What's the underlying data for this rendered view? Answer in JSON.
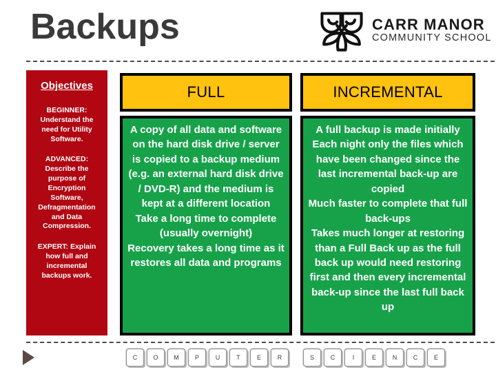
{
  "slide": {
    "title": "Backups"
  },
  "logo": {
    "icon": "owl-logo-icon",
    "name": "CARR MANOR",
    "subtitle": "COMMUNITY SCHOOL"
  },
  "objectives": {
    "title": "Objectives",
    "background_color": "#b00712",
    "items": [
      "BEGINNER: Understand the need for Utility Software.",
      "ADVANCED: Describe the purpose of Encryption Software, Defragmentation and Data Compression.",
      "EXPERT: Explain how full and incremental backups work."
    ]
  },
  "columns": [
    {
      "header": "FULL",
      "header_color": "#ffc20e",
      "body_color": "#17a24a",
      "lines": [
        "A copy of all data and software on the hard disk drive / server is copied to a backup medium (e.g. an external hard disk drive / DVD-R) and the medium is kept at a different location",
        "Take a long time to complete (usually overnight)",
        "Recovery takes a long time as it restores all data and programs"
      ]
    },
    {
      "header": "INCREMENTAL",
      "header_color": "#ffc20e",
      "body_color": "#17a24a",
      "lines": [
        "A full backup is made initially",
        "Each night only the files which have been changed since the last incremental back-up are copied",
        "Much faster to complete that full back-ups",
        "Takes much longer at restoring than a Full Back up as the full back up would need restoring first and then every incremental back-up since the last full back up"
      ]
    }
  ],
  "footer": {
    "arrow_icon": "play-triangle-icon",
    "key_groups": [
      {
        "name": "computer",
        "keys": [
          "C",
          "O",
          "M",
          "P",
          "U",
          "T",
          "E",
          "R"
        ]
      },
      {
        "name": "science",
        "keys": [
          "S",
          "C",
          "I",
          "E",
          "N",
          "C",
          "E"
        ]
      }
    ]
  }
}
